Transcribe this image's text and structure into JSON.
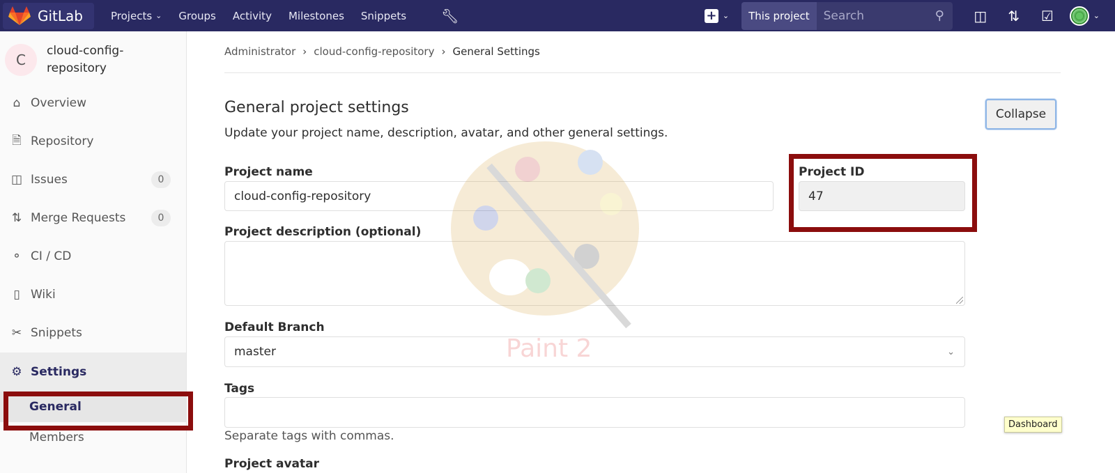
{
  "topbar": {
    "brand": "GitLab",
    "nav": [
      {
        "label": "Projects",
        "has_dropdown": true
      },
      {
        "label": "Groups"
      },
      {
        "label": "Activity"
      },
      {
        "label": "Milestones"
      },
      {
        "label": "Snippets"
      }
    ],
    "admin_icon": "wrench-icon",
    "new_icon": "plus-square-icon",
    "search_scope": "This project",
    "search_placeholder": "Search",
    "right_icons": [
      "issues-icon",
      "merge-request-icon",
      "todo-check-icon"
    ],
    "colors": {
      "navbar": "#292961"
    }
  },
  "sidebar": {
    "project_initial": "C",
    "project_name": "cloud-config-repository",
    "items": [
      {
        "label": "Overview",
        "icon": "home-icon"
      },
      {
        "label": "Repository",
        "icon": "document-icon"
      },
      {
        "label": "Issues",
        "icon": "issues-icon",
        "count": "0"
      },
      {
        "label": "Merge Requests",
        "icon": "merge-request-icon",
        "count": "0"
      },
      {
        "label": "CI / CD",
        "icon": "rocket-icon"
      },
      {
        "label": "Wiki",
        "icon": "book-icon"
      },
      {
        "label": "Snippets",
        "icon": "scissors-icon"
      },
      {
        "label": "Settings",
        "icon": "gear-icon",
        "active": true
      }
    ],
    "sub_items": [
      {
        "label": "General",
        "active": true
      },
      {
        "label": "Members"
      }
    ]
  },
  "breadcrumb": {
    "items": [
      "Administrator",
      "cloud-config-repository",
      "General Settings"
    ]
  },
  "section": {
    "title": "General project settings",
    "description": "Update your project name, description, avatar, and other general settings.",
    "collapse_label": "Collapse"
  },
  "form": {
    "project_name_label": "Project name",
    "project_name_value": "cloud-config-repository",
    "project_id_label": "Project ID",
    "project_id_value": "47",
    "description_label": "Project description (optional)",
    "description_value": "",
    "default_branch_label": "Default Branch",
    "default_branch_value": "master",
    "tags_label": "Tags",
    "tags_value": "",
    "tags_help": "Separate tags with commas.",
    "avatar_label": "Project avatar"
  },
  "watermark_text": "Paint 2",
  "tooltip": "Dashboard",
  "highlight_color": "#8b0d0d"
}
